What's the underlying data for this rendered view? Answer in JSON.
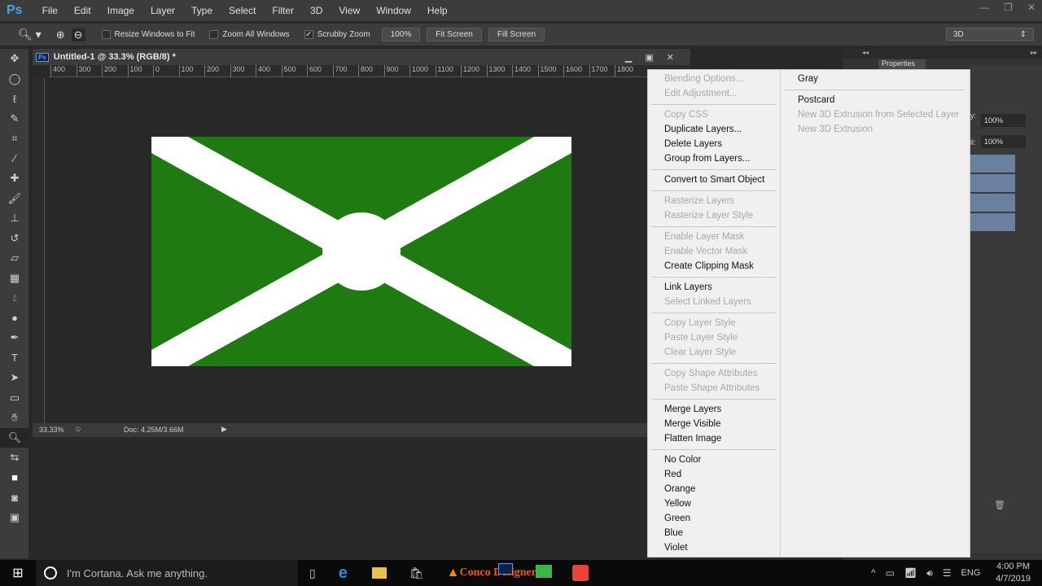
{
  "app": {
    "logo": "Ps",
    "menu": [
      "File",
      "Edit",
      "Image",
      "Layer",
      "Type",
      "Select",
      "Filter",
      "3D",
      "View",
      "Window",
      "Help"
    ]
  },
  "options": {
    "resize_windows": "Resize Windows to Fit",
    "zoom_all": "Zoom All Windows",
    "scrubby": "Scrubby Zoom",
    "btn_100": "100%",
    "fit_screen": "Fit Screen",
    "fill_screen": "Fill Screen",
    "workspace": "3D"
  },
  "document": {
    "title": "Untitled-1 @ 33.3% (RGB/8) *",
    "zoom": "33.33%",
    "doc_size": "Doc: 4.25M/3.66M",
    "ruler": [
      "400",
      "300",
      "200",
      "100",
      "0",
      "100",
      "200",
      "300",
      "400",
      "500",
      "600",
      "700",
      "800",
      "900",
      "1000",
      "1100",
      "1200",
      "1300",
      "1400",
      "1500",
      "1600",
      "1700",
      "1800"
    ],
    "canvas_color": "#1f7a12"
  },
  "panels": {
    "properties_tab": "Properties",
    "opacity": "100%",
    "fill": "100%",
    "opacity_label": "y:",
    "fill_label": "ll:"
  },
  "context_menu": {
    "left": [
      [
        "Blending Options...",
        0
      ],
      [
        "Edit Adjustment...",
        0
      ],
      null,
      [
        "Copy CSS",
        0
      ],
      [
        "Duplicate Layers...",
        1
      ],
      [
        "Delete Layers",
        1
      ],
      [
        "Group from Layers...",
        1
      ],
      null,
      [
        "Convert to Smart Object",
        1
      ],
      null,
      [
        "Rasterize Layers",
        0
      ],
      [
        "Rasterize Layer Style",
        0
      ],
      null,
      [
        "Enable Layer Mask",
        0
      ],
      [
        "Enable Vector Mask",
        0
      ],
      [
        "Create Clipping Mask",
        1
      ],
      null,
      [
        "Link Layers",
        1
      ],
      [
        "Select Linked Layers",
        0
      ],
      null,
      [
        "Copy Layer Style",
        0
      ],
      [
        "Paste Layer Style",
        0
      ],
      [
        "Clear Layer Style",
        0
      ],
      null,
      [
        "Copy Shape Attributes",
        0
      ],
      [
        "Paste Shape Attributes",
        0
      ],
      null,
      [
        "Merge Layers",
        1
      ],
      [
        "Merge Visible",
        1
      ],
      [
        "Flatten Image",
        1
      ],
      null,
      [
        "No Color",
        1
      ],
      [
        "Red",
        1
      ],
      [
        "Orange",
        1
      ],
      [
        "Yellow",
        1
      ],
      [
        "Green",
        1
      ],
      [
        "Blue",
        1
      ],
      [
        "Violet",
        1
      ]
    ],
    "right": [
      [
        "Gray",
        1
      ],
      null,
      [
        "Postcard",
        1
      ],
      [
        "New 3D Extrusion from Selected Layer",
        0
      ],
      [
        "New 3D Extrusion",
        0
      ]
    ]
  },
  "taskbar": {
    "cortana": "I'm Cortana. Ask me anything.",
    "watermark": "Conco Designer",
    "lang": "ENG",
    "time": "4:00 PM",
    "date": "4/7/2019"
  }
}
